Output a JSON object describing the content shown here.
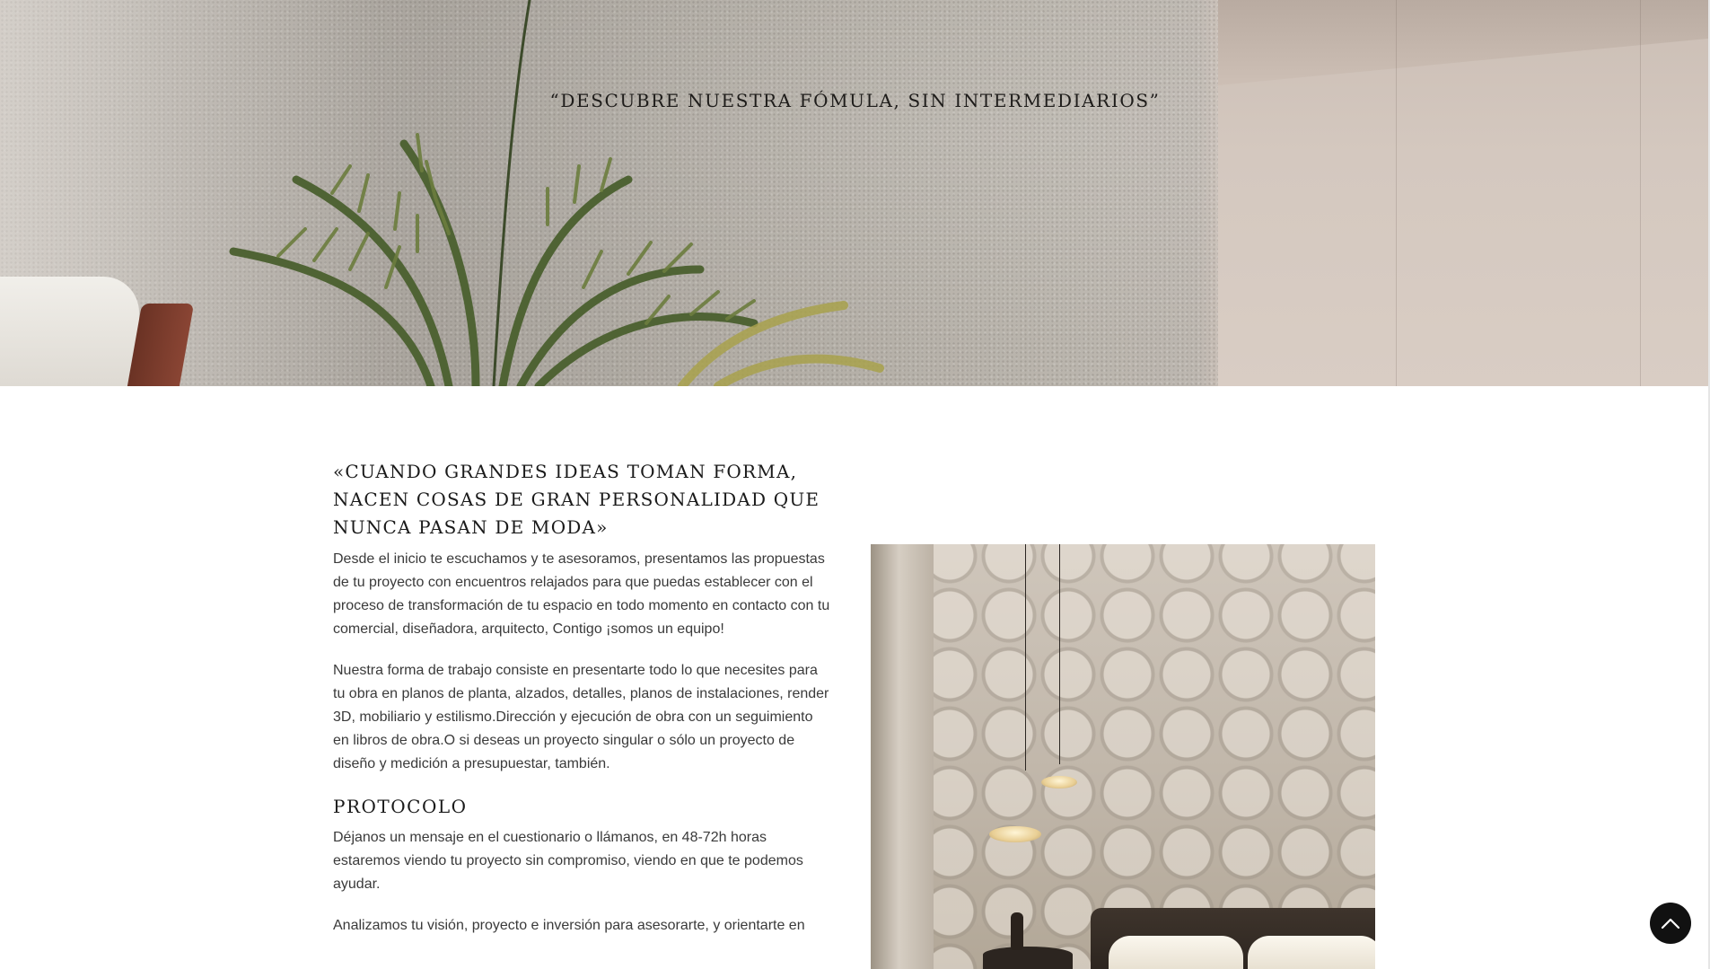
{
  "hero": {
    "quote": "“DESCUBRE NUESTRA FÓMULA, SIN INTERMEDIARIOS”"
  },
  "main": {
    "title": "«CUANDO GRANDES IDEAS TOMAN FORMA, NACEN COSAS DE GRAN PERSONALIDAD QUE NUNCA PASAN DE MODA»",
    "intro": "Desde el inicio te escuchamos y te asesoramos, presentamos las propuestas de tu proyecto con encuentros relajados para que puedas establecer con el proceso de transformación de tu espacio en todo momento en contacto con tu comercial, diseñadora, arquitecto, Contigo ¡somos un equipo!",
    "method": "Nuestra forma de trabajo consiste en presentarte todo lo que necesites para tu obra en planos de planta, alzados, detalles, planos de instalaciones, render 3D,  mobiliario y estilismo.Dirección y ejecución de obra con un seguimiento en libros de obra.O si deseas un proyecto singular o sólo un proyecto de diseño y medición a presupuestar, también.",
    "protocol_heading": "PROTOCOLO",
    "protocol_text": "Déjanos un mensaje en el cuestionario o llámanos, en 48-72h  horas estaremos viendo tu proyecto sin compromiso, viendo en que te podemos ayudar.",
    "analysis_text": "Analizamos tu visión, proyecto e inversión para asesorarte, y orientarte en"
  },
  "controls": {
    "scroll_top_icon": "chevron-up-icon"
  },
  "colors": {
    "text_dark": "#1a1a1a",
    "body_text": "#3a3a3a",
    "scroll_button": "#111111"
  }
}
